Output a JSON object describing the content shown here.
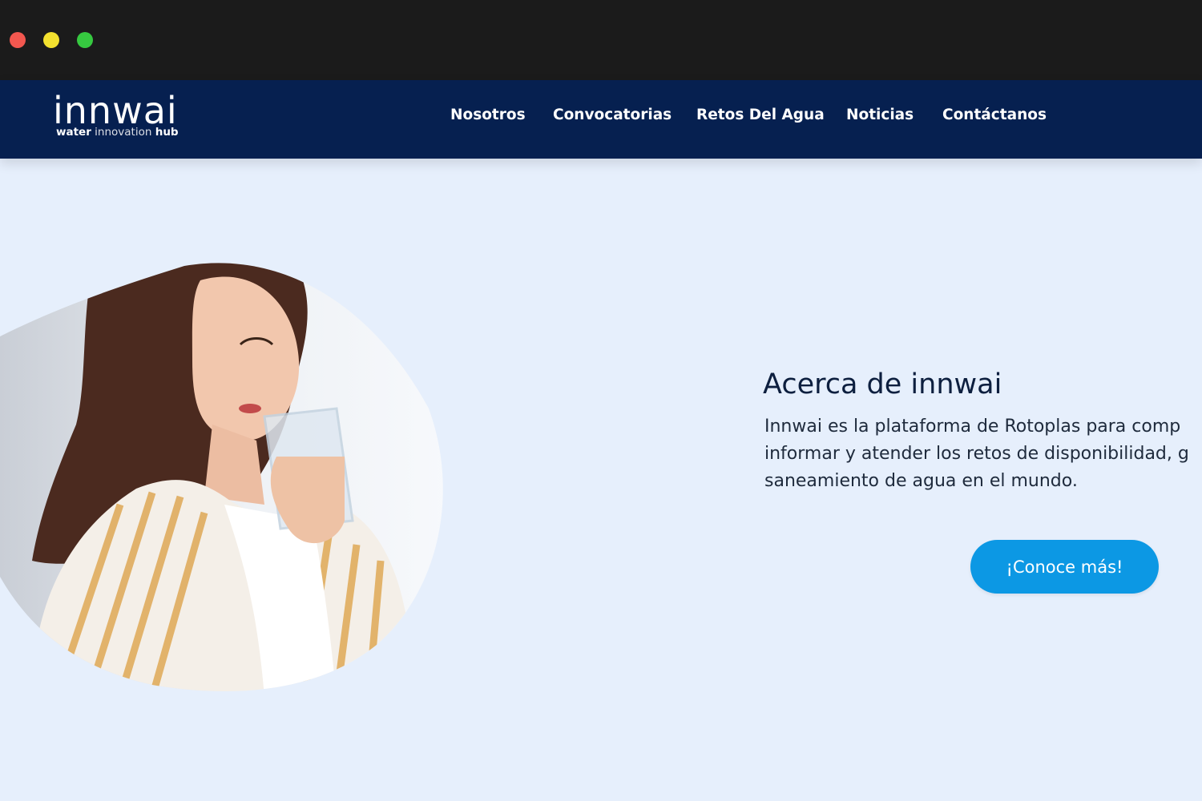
{
  "window": {
    "controls": [
      "close",
      "minimize",
      "maximize"
    ],
    "colors": {
      "close": "#f2574f",
      "minimize": "#f3e12f",
      "maximize": "#36c940"
    }
  },
  "header": {
    "logo_word": "innwai",
    "logo_tag_bold_1": "water",
    "logo_tag_light": "innovation",
    "logo_tag_bold_2": "hub",
    "nav": [
      {
        "label": "Nosotros"
      },
      {
        "label": "Convocatorias"
      },
      {
        "label": "Retos Del Agua"
      },
      {
        "label": "Noticias"
      },
      {
        "label": "Contáctanos"
      }
    ]
  },
  "about": {
    "title": "Acerca de innwai",
    "text_lines": [
      "Innwai es la plataforma de Rotoplas para comp",
      "informar y atender los retos de disponibilidad, g",
      "saneamiento de agua en el mundo."
    ],
    "cta_label": "¡Conoce más!"
  },
  "hero": {
    "image_subject": "woman-drinking-water-glass"
  },
  "colors": {
    "navbar": "#062050",
    "page_bg": "#e6effc",
    "accent_button": "#0c98e4",
    "title_text": "#0d1f3f"
  }
}
